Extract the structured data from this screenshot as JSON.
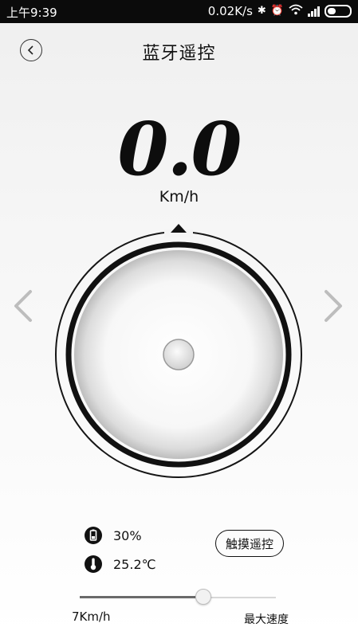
{
  "status_bar": {
    "time": "上午9:39",
    "network_speed": "0.02K/s",
    "icons": [
      "bluetooth-icon",
      "alarm-icon",
      "wifi-icon",
      "signal-icon",
      "battery-icon"
    ]
  },
  "header": {
    "title": "蓝牙遥控",
    "back_icon": "chevron-left-icon"
  },
  "speed": {
    "value": "0.0",
    "unit": "Km/h"
  },
  "joystick": {
    "left_icon": "chevron-left-icon",
    "right_icon": "chevron-right-icon"
  },
  "stats": {
    "battery": "30%",
    "temperature": "25.2℃"
  },
  "touch_remote_label": "触摸遥控",
  "speed_limit": {
    "min_label": "7Km/h",
    "max_label": "最大速度",
    "level": 0.63
  },
  "colors": {
    "status_bar_bg": "#0b0b0b",
    "text": "#111111",
    "ring": "#111111"
  }
}
